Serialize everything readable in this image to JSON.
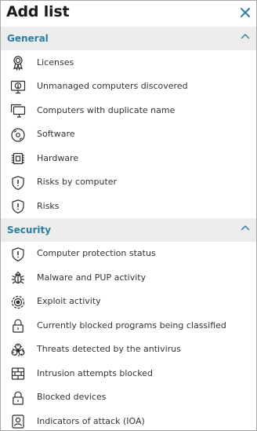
{
  "panel": {
    "title": "Add list"
  },
  "sections": [
    {
      "title": "General",
      "items": [
        {
          "label": "Licenses",
          "icon": "award-ribbon-icon"
        },
        {
          "label": "Unmanaged computers discovered",
          "icon": "monitor-alert-icon"
        },
        {
          "label": "Computers with duplicate name",
          "icon": "duplicate-monitors-icon"
        },
        {
          "label": "Software",
          "icon": "disc-icon"
        },
        {
          "label": "Hardware",
          "icon": "chip-icon"
        },
        {
          "label": "Risks by computer",
          "icon": "shield-alert-icon"
        },
        {
          "label": "Risks",
          "icon": "shield-alert-icon"
        }
      ]
    },
    {
      "title": "Security",
      "items": [
        {
          "label": "Computer protection status",
          "icon": "shield-alert-icon"
        },
        {
          "label": "Malware and PUP activity",
          "icon": "bug-icon"
        },
        {
          "label": "Exploit activity",
          "icon": "target-icon"
        },
        {
          "label": "Currently blocked programs being classified",
          "icon": "padlock-icon"
        },
        {
          "label": "Threats detected by the antivirus",
          "icon": "biohazard-icon"
        },
        {
          "label": "Intrusion attempts blocked",
          "icon": "firewall-icon"
        },
        {
          "label": "Blocked devices",
          "icon": "padlock-icon"
        },
        {
          "label": "Indicators of attack (IOA)",
          "icon": "id-badge-icon"
        }
      ]
    }
  ],
  "colors": {
    "accent": "#2a7f9c",
    "section_bg": "#ececec",
    "text": "#333333",
    "icon": "#2b2b2b"
  }
}
